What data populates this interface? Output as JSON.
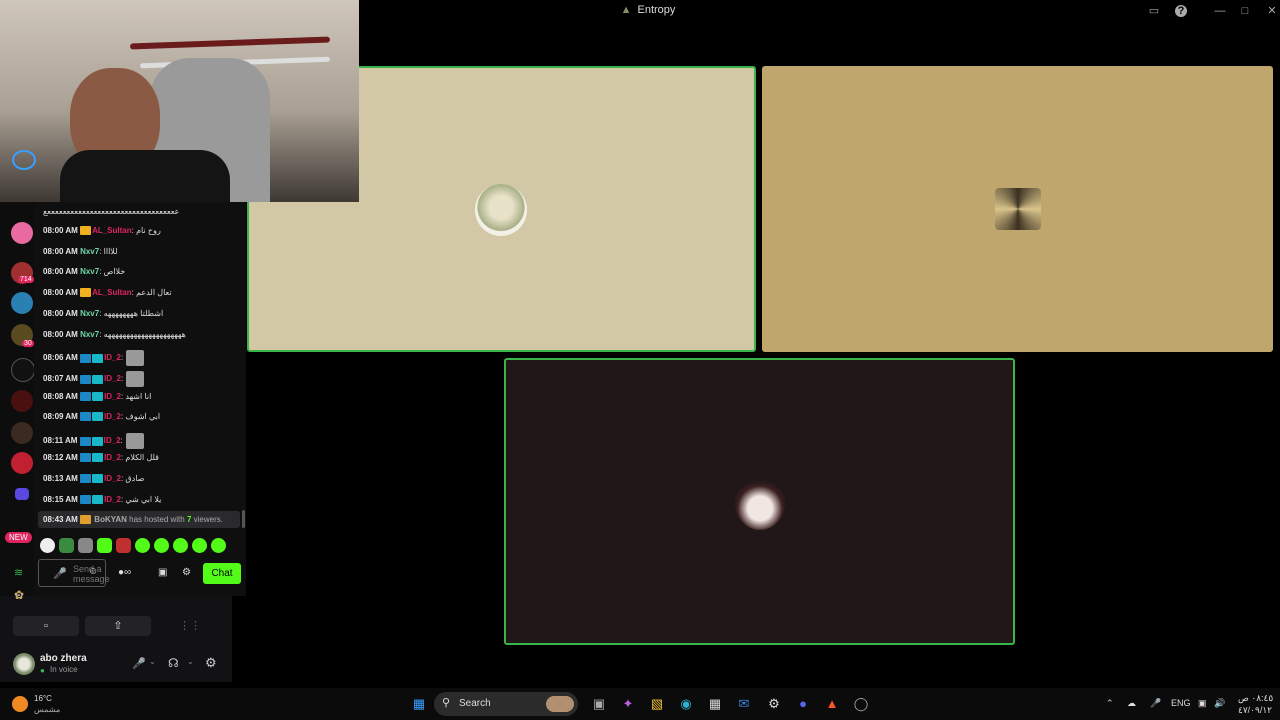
{
  "window": {
    "title": "Entropy",
    "buttons": [
      "▭",
      "?",
      "—",
      "□",
      "✕"
    ]
  },
  "chat": {
    "top_line": "ععععععععععععععععععععععععععععععععععع",
    "messages": [
      {
        "time": "08:00 AM",
        "user": "AL_Sultan",
        "text": ": روح نام",
        "color": "#e0245e",
        "badge": "crown"
      },
      {
        "time": "08:00 AM",
        "user": "Nxv7",
        "text": ": للاااا",
        "color": "#70d6a9",
        "badge": ""
      },
      {
        "time": "08:00 AM",
        "user": "Nxv7",
        "text": ": خلااص",
        "color": "#70d6a9",
        "badge": ""
      },
      {
        "time": "08:00 AM",
        "user": "AL_Sultan",
        "text": ": تعال الدعم",
        "color": "#e0245e",
        "badge": "crown"
      },
      {
        "time": "08:00 AM",
        "user": "Nxv7",
        "text": ": اشطلتا ههههههههه",
        "color": "#70d6a9",
        "badge": ""
      },
      {
        "time": "08:00 AM",
        "user": "Nxv7",
        "text": ": هههههههههههههههههههههه",
        "color": "#70d6a9",
        "badge": ""
      },
      {
        "time": "08:06 AM",
        "user": "ID_2",
        "text": ":",
        "color": "#e0245e",
        "badge": "mod",
        "emote": true
      },
      {
        "time": "08:07 AM",
        "user": "ID_2",
        "text": ":",
        "color": "#e0245e",
        "badge": "mod",
        "emote": true
      },
      {
        "time": "08:08 AM",
        "user": "ID_2",
        "text": ": انا اشهد",
        "color": "#e0245e",
        "badge": "mod"
      },
      {
        "time": "08:09 AM",
        "user": "ID_2",
        "text": ": ابي اشوف",
        "color": "#e0245e",
        "badge": "mod"
      },
      {
        "time": "08:11 AM",
        "user": "ID_2",
        "text": ":",
        "color": "#e0245e",
        "badge": "mod",
        "emote": true
      },
      {
        "time": "08:12 AM",
        "user": "ID_2",
        "text": ": قلل الكلام",
        "color": "#e0245e",
        "badge": "mod"
      },
      {
        "time": "08:13 AM",
        "user": "ID_2",
        "text": ": صادق",
        "color": "#e0245e",
        "badge": "mod"
      },
      {
        "time": "08:15 AM",
        "user": "ID_2",
        "text": ": يلا ابي شي",
        "color": "#e0245e",
        "badge": "mod"
      }
    ],
    "host": {
      "time": "08:43 AM",
      "user": "BoKYAN",
      "text_before": "has hosted with",
      "count": "7",
      "text_after": "viewers."
    },
    "input_placeholder": "Send a message",
    "chat_button": "Chat",
    "accent": "#53fc18"
  },
  "sidebar": {
    "new_badge": "NEW",
    "badge_counts": [
      "714",
      "30"
    ]
  },
  "voice_panel": {
    "user_name": "abo zhera",
    "status": "In voice"
  },
  "taskbar": {
    "search_label": "Search",
    "weather_temp": "16°C",
    "weather_desc": "مشمس",
    "language": "ENG",
    "time": "٠٨:٤٥ ص",
    "date": "٤٧/٠٩/١٢"
  }
}
